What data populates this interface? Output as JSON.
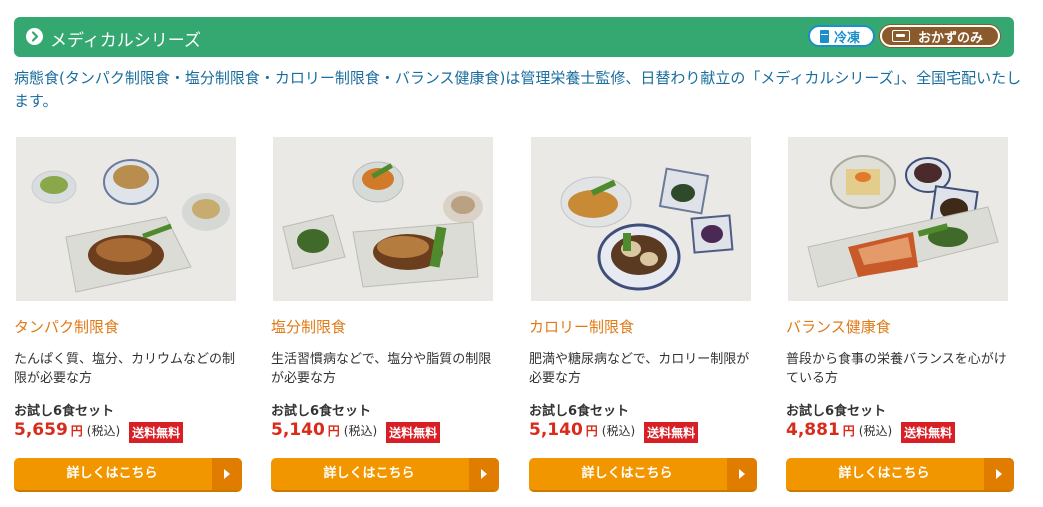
{
  "header": {
    "title": "メディカルシリーズ",
    "badges": [
      "冷凍",
      "おかずのみ"
    ]
  },
  "intro": "病態食(タンパク制限食・塩分制限食・カロリー制限食・バランス健康食)は管理栄養士監修、日替わり献立の「メディカルシリーズ」、全国宅配いたします。",
  "products": [
    {
      "name": "タンパク制限食",
      "description": "たんぱく質、塩分、カリウムなどの制限が必要な方",
      "set_label": "お試し6食セット",
      "price": "5,659",
      "yen": "円",
      "tax": "(税込)",
      "shipping": "送料無料",
      "button": "詳しくはこちら"
    },
    {
      "name": "塩分制限食",
      "description": "生活習慣病などで、塩分や脂質の制限が必要な方",
      "set_label": "お試し6食セット",
      "price": "5,140",
      "yen": "円",
      "tax": "(税込)",
      "shipping": "送料無料",
      "button": "詳しくはこちら"
    },
    {
      "name": "カロリー制限食",
      "description": "肥満や糖尿病などで、カロリー制限が必要な方",
      "set_label": "お試し6食セット",
      "price": "5,140",
      "yen": "円",
      "tax": "(税込)",
      "shipping": "送料無料",
      "button": "詳しくはこちら"
    },
    {
      "name": "バランス健康食",
      "description": "普段から食事の栄養バランスを心がけている方",
      "set_label": "お試し6食セット",
      "price": "4,881",
      "yen": "円",
      "tax": "(税込)",
      "shipping": "送料無料",
      "button": "詳しくはこちら"
    }
  ],
  "colors": {
    "header_green": "#35a871",
    "accent_orange": "#e07a16",
    "price_red": "#d92b1c",
    "button_orange": "#f29600",
    "frozen_blue": "#1a8fc9",
    "okazu_brown": "#8b5a2b"
  }
}
